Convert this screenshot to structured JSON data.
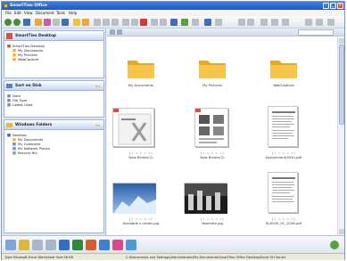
{
  "window": {
    "title": "SmartTies Office"
  },
  "menu": [
    "File",
    "Edit",
    "View",
    "Document",
    "Tools",
    "Help"
  ],
  "sidebar": {
    "panels": [
      {
        "title": "SmartTies Desktop",
        "items": [
          "SmartTies Desktop",
          "My Documents",
          "My Pictures",
          "WebCapture"
        ]
      },
      {
        "title": "Sort on Disk",
        "items": [
          "Date",
          "File Type",
          "Latest Used"
        ]
      },
      {
        "title": "Windows Folders",
        "items": [
          "Desktop",
          "My Documents",
          "My Computer",
          "My Network Places",
          "Recycle Bin"
        ]
      }
    ]
  },
  "content": {
    "rows": [
      [
        {
          "type": "folder",
          "caption": "My Documents",
          "stars": ""
        },
        {
          "type": "folder",
          "caption": "My Pictures",
          "stars": ""
        },
        {
          "type": "folder",
          "caption": "WebCapture",
          "stars": ""
        }
      ],
      [
        {
          "type": "doc-x",
          "caption": "New Binder(1)",
          "stars": "(☆ ☆  ☆  ☆  ☆)"
        },
        {
          "type": "doc-grid",
          "caption": "New Binder(2)",
          "stars": "(☆ ☆  ☆  ☆  ☆)"
        },
        {
          "type": "doc-text",
          "caption": "Assignment(XXX).pdf",
          "stars": "(☆ ☆  ☆  ☆  ☆)"
        }
      ],
      [
        {
          "type": "photo-ice",
          "caption": "Available s rubies.jpg",
          "stars": "(☆ ☆  ☆  ☆  ☆)"
        },
        {
          "type": "photo-city",
          "caption": "Yosemite.jpg",
          "stars": "(☆ ☆  ☆  ☆  ☆)"
        },
        {
          "type": "doc-text",
          "caption": "SLX045_01_1026.pdf",
          "stars": "(☆ ☆  ☆  ☆  ☆)"
        }
      ]
    ]
  },
  "statusbar": {
    "left": "Type:Microsoft Excel Worksheet Size:38 KB",
    "right": "C:\\Documents and Settings\\Administrator\\My Documents\\SmartTies Office Desktop\\Excel SH list.xls"
  },
  "colors": {
    "titlebar": "#2a66d6",
    "sidebar": "#dfe8f7",
    "folder": "#f0b72a",
    "accent": "#4a7bd0"
  }
}
